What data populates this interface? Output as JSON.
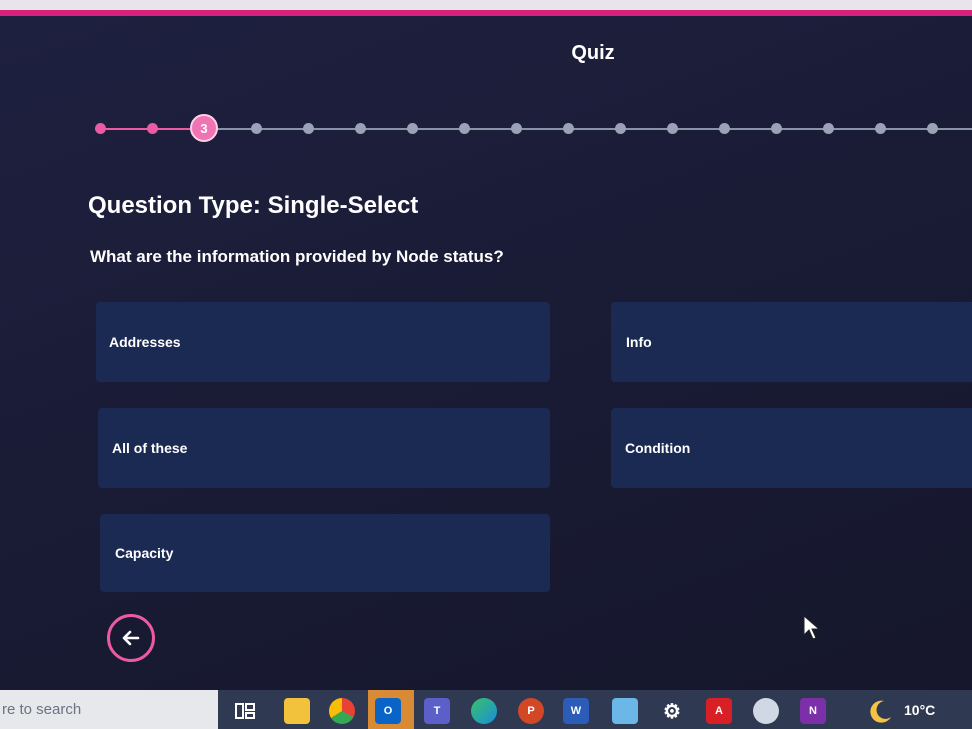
{
  "header": {
    "title": "Quiz"
  },
  "progress": {
    "current_step": "3",
    "current_index": 2,
    "total_visible_steps": 18
  },
  "question": {
    "type_label": "Question Type: Single-Select",
    "text": "What are the information provided by Node status?"
  },
  "options": [
    {
      "label": "Addresses"
    },
    {
      "label": "Info"
    },
    {
      "label": "All of these"
    },
    {
      "label": "Condition"
    },
    {
      "label": "Capacity"
    }
  ],
  "navigation": {
    "back_icon": "arrow-left-icon"
  },
  "taskbar": {
    "search_text": "re to search",
    "weather_temp": "10°C",
    "apps": [
      "task-view-icon",
      "file-explorer-icon",
      "chrome-icon",
      "outlook-icon",
      "teams-icon",
      "edge-icon",
      "powerpoint-icon",
      "word-icon",
      "snipping-tool-icon",
      "settings-icon",
      "acrobat-icon",
      "paint-icon",
      "onenote-icon"
    ]
  },
  "colors": {
    "accent": "#ec5aa3",
    "background": "#1b1c36",
    "option_bg": "#1a2a52",
    "step_inactive": "#9aa3b5",
    "top_bar": "#d6207c"
  }
}
